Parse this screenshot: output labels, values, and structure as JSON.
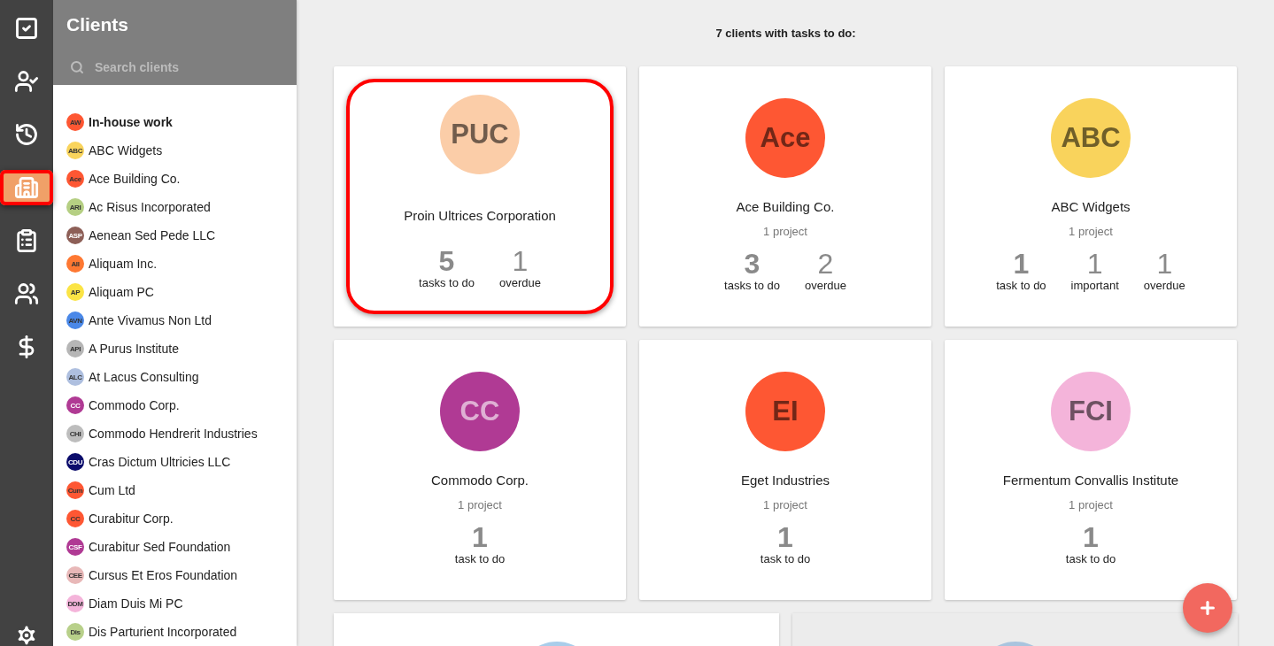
{
  "rail": {
    "items": [
      {
        "selected": false,
        "highlighted": false
      },
      {
        "selected": false,
        "highlighted": false
      },
      {
        "selected": false,
        "highlighted": false
      },
      {
        "selected": true,
        "highlighted": true
      },
      {
        "selected": false,
        "highlighted": false
      },
      {
        "selected": false,
        "highlighted": false
      },
      {
        "selected": false,
        "highlighted": false
      }
    ]
  },
  "clients_panel": {
    "title": "Clients",
    "search": {
      "placeholder": "Search clients"
    },
    "items": [
      {
        "initials": "AW",
        "name": "In-house work",
        "color": "#fe5733",
        "selected": true
      },
      {
        "initials": "ABC",
        "name": "ABC Widgets",
        "color": "#f9d45c",
        "selected": false
      },
      {
        "initials": "Ace",
        "name": "Ace Building Co.",
        "color": "#fe5733",
        "selected": false
      },
      {
        "initials": "ARI",
        "name": "Ac Risus Incorporated",
        "color": "#b5cf83",
        "selected": false
      },
      {
        "initials": "ASP",
        "name": "Aenean Sed Pede LLC",
        "color": "#8d5f57",
        "selected": false
      },
      {
        "initials": "AII",
        "name": "Aliquam Inc.",
        "color": "#fe7832",
        "selected": false
      },
      {
        "initials": "AP",
        "name": "Aliquam PC",
        "color": "#fbe445",
        "selected": false
      },
      {
        "initials": "AVN",
        "name": "Ante Vivamus Non Ltd",
        "color": "#4a88e8",
        "selected": false
      },
      {
        "initials": "API",
        "name": "A Purus Institute",
        "color": "#b6b6b6",
        "selected": false
      },
      {
        "initials": "ALC",
        "name": "At Lacus Consulting",
        "color": "#aebfdf",
        "selected": false
      },
      {
        "initials": "CC",
        "name": "Commodo Corp.",
        "color": "#b03a94",
        "selected": false
      },
      {
        "initials": "CHI",
        "name": "Commodo Hendrerit Industries",
        "color": "#bdbdbd",
        "selected": false
      },
      {
        "initials": "CDU",
        "name": "Cras Dictum Ultricies LLC",
        "color": "#0b0c6b",
        "selected": false
      },
      {
        "initials": "Cum",
        "name": "Cum Ltd",
        "color": "#fe5733",
        "selected": false
      },
      {
        "initials": "CC",
        "name": "Curabitur Corp.",
        "color": "#fe5733",
        "selected": false
      },
      {
        "initials": "CSF",
        "name": "Curabitur Sed Foundation",
        "color": "#b03a94",
        "selected": false
      },
      {
        "initials": "CEE",
        "name": "Cursus Et Eros Foundation",
        "color": "#e8b8b8",
        "selected": false
      },
      {
        "initials": "DDM",
        "name": "Diam Duis Mi PC",
        "color": "#f4b4da",
        "selected": false
      },
      {
        "initials": "Dis",
        "name": "Dis Parturient Incorporated",
        "color": "#b8d08a",
        "selected": false
      }
    ]
  },
  "main": {
    "heading": "7 clients with tasks to do:",
    "cards": [
      {
        "initials": "PUC",
        "name": "Proin Ultrices Corporation",
        "color": "#fbcda8",
        "highlighted": true,
        "stats": [
          {
            "kind": "tasks",
            "value": "5",
            "label": "tasks to do"
          },
          {
            "kind": "overdue",
            "value": "1",
            "label": "overdue"
          }
        ]
      },
      {
        "initials": "Ace",
        "name": "Ace Building Co.",
        "project": "1 project",
        "color": "#fe5733",
        "highlighted": false,
        "stats": [
          {
            "kind": "tasks",
            "value": "3",
            "label": "tasks to do"
          },
          {
            "kind": "overdue",
            "value": "2",
            "label": "overdue"
          }
        ]
      },
      {
        "initials": "ABC",
        "name": "ABC Widgets",
        "project": "1 project",
        "color": "#f9d35c",
        "highlighted": false,
        "stats": [
          {
            "kind": "tasks",
            "value": "1",
            "label": "task to do"
          },
          {
            "kind": "important",
            "value": "1",
            "label": "important"
          },
          {
            "kind": "overdue",
            "value": "1",
            "label": "overdue"
          }
        ]
      },
      {
        "initials": "CC",
        "name": "Commodo Corp.",
        "project": "1 project",
        "color": "#b03a94",
        "highlighted": false,
        "stats": [
          {
            "kind": "tasks",
            "value": "1",
            "label": "task to do"
          }
        ]
      },
      {
        "initials": "EI",
        "name": "Eget Industries",
        "project": "1 project",
        "color": "#fe5733",
        "highlighted": false,
        "stats": [
          {
            "kind": "tasks",
            "value": "1",
            "label": "task to do"
          }
        ]
      },
      {
        "initials": "FCI",
        "name": "Fermentum Convallis Institute",
        "project": "1 project",
        "color": "#f4b4da",
        "highlighted": false,
        "stats": [
          {
            "kind": "tasks",
            "value": "1",
            "label": "task to do"
          }
        ]
      }
    ],
    "partial_cards": [
      {
        "color": "#a9cdea",
        "shaded": false
      },
      {
        "color": "#a9c4de",
        "shaded": true
      }
    ]
  }
}
